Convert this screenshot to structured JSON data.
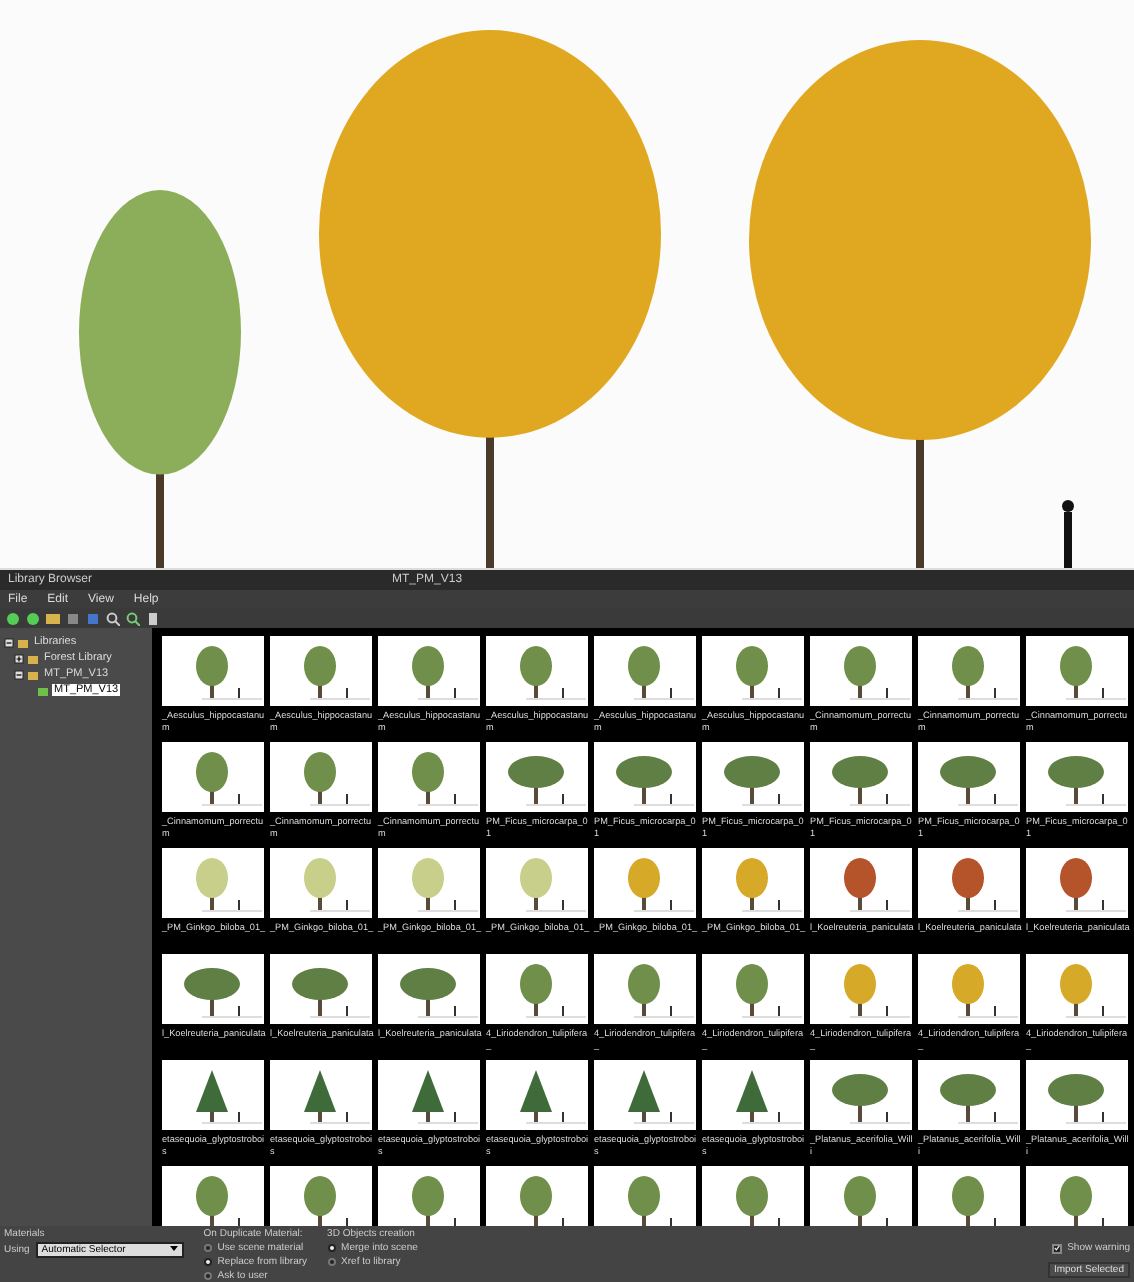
{
  "window": {
    "title": "Library Browser",
    "document": "MT_PM_V13"
  },
  "menu": [
    "File",
    "Edit",
    "View",
    "Help"
  ],
  "sidebar": {
    "items": [
      {
        "label": "Libraries",
        "expanded": true,
        "selected": false,
        "children": [
          {
            "label": "Forest Library",
            "expanded": false,
            "selected": false
          },
          {
            "label": "MT_PM_V13",
            "expanded": true,
            "selected": false,
            "children": [
              {
                "label": "MT_PM_V13",
                "selected": true
              }
            ]
          }
        ]
      }
    ]
  },
  "thumbnails": [
    {
      "label": "_Aesculus_hippocastanum",
      "kind": "green"
    },
    {
      "label": "_Aesculus_hippocastanum",
      "kind": "green"
    },
    {
      "label": "_Aesculus_hippocastanum",
      "kind": "green"
    },
    {
      "label": "_Aesculus_hippocastanum",
      "kind": "green"
    },
    {
      "label": "_Aesculus_hippocastanum",
      "kind": "green"
    },
    {
      "label": "_Aesculus_hippocastanum",
      "kind": "green"
    },
    {
      "label": "_Cinnamomum_porrectum",
      "kind": "green"
    },
    {
      "label": "_Cinnamomum_porrectum",
      "kind": "green"
    },
    {
      "label": "_Cinnamomum_porrectum",
      "kind": "green"
    },
    {
      "label": "_Cinnamomum_porrectum",
      "kind": "green"
    },
    {
      "label": "_Cinnamomum_porrectum",
      "kind": "green"
    },
    {
      "label": "_Cinnamomum_porrectum",
      "kind": "green"
    },
    {
      "label": "PM_Ficus_microcarpa_01",
      "kind": "wide"
    },
    {
      "label": "PM_Ficus_microcarpa_01",
      "kind": "wide"
    },
    {
      "label": "PM_Ficus_microcarpa_01",
      "kind": "wide"
    },
    {
      "label": "PM_Ficus_microcarpa_01",
      "kind": "wide"
    },
    {
      "label": "PM_Ficus_microcarpa_01",
      "kind": "wide"
    },
    {
      "label": "PM_Ficus_microcarpa_01",
      "kind": "wide"
    },
    {
      "label": "_PM_Ginkgo_biloba_01_",
      "kind": "pale"
    },
    {
      "label": "_PM_Ginkgo_biloba_01_",
      "kind": "pale"
    },
    {
      "label": "_PM_Ginkgo_biloba_01_",
      "kind": "pale"
    },
    {
      "label": "_PM_Ginkgo_biloba_01_",
      "kind": "pale"
    },
    {
      "label": "_PM_Ginkgo_biloba_01_",
      "kind": "yellow"
    },
    {
      "label": "_PM_Ginkgo_biloba_01_",
      "kind": "yellow"
    },
    {
      "label": "l_Koelreuteria_paniculata",
      "kind": "red"
    },
    {
      "label": "l_Koelreuteria_paniculata",
      "kind": "red"
    },
    {
      "label": "l_Koelreuteria_paniculata",
      "kind": "red"
    },
    {
      "label": "l_Koelreuteria_paniculata",
      "kind": "wide"
    },
    {
      "label": "l_Koelreuteria_paniculata",
      "kind": "wide"
    },
    {
      "label": "l_Koelreuteria_paniculata",
      "kind": "wide"
    },
    {
      "label": "4_Liriodendron_tulipifera_",
      "kind": "green"
    },
    {
      "label": "4_Liriodendron_tulipifera_",
      "kind": "green"
    },
    {
      "label": "4_Liriodendron_tulipifera_",
      "kind": "green"
    },
    {
      "label": "4_Liriodendron_tulipifera_",
      "kind": "yellow"
    },
    {
      "label": "4_Liriodendron_tulipifera_",
      "kind": "yellow"
    },
    {
      "label": "4_Liriodendron_tulipifera_",
      "kind": "yellow"
    },
    {
      "label": "etasequoia_glyptostrobois",
      "kind": "conifer"
    },
    {
      "label": "etasequoia_glyptostrobois",
      "kind": "conifer"
    },
    {
      "label": "etasequoia_glyptostrobois",
      "kind": "conifer"
    },
    {
      "label": "etasequoia_glyptostrobois",
      "kind": "conifer"
    },
    {
      "label": "etasequoia_glyptostrobois",
      "kind": "conifer"
    },
    {
      "label": "etasequoia_glyptostrobois",
      "kind": "conifer"
    },
    {
      "label": "_Platanus_acerifolia_Willi",
      "kind": "wide"
    },
    {
      "label": "_Platanus_acerifolia_Willi",
      "kind": "wide"
    },
    {
      "label": "_Platanus_acerifolia_Willi",
      "kind": "wide"
    },
    {
      "kind": "green"
    },
    {
      "kind": "green"
    },
    {
      "kind": "green"
    },
    {
      "kind": "green"
    },
    {
      "kind": "green"
    },
    {
      "kind": "green"
    },
    {
      "kind": "green"
    },
    {
      "kind": "green"
    },
    {
      "kind": "green"
    }
  ],
  "materials": {
    "title": "Materials",
    "using_label": "Using",
    "using_value": "Automatic Selector"
  },
  "duplicate": {
    "title": "On Duplicate Material:",
    "options": [
      {
        "label": "Use scene material",
        "selected": false
      },
      {
        "label": "Replace from library",
        "selected": true
      },
      {
        "label": "Ask to user",
        "selected": false
      }
    ]
  },
  "creation": {
    "title": "3D Objects creation",
    "options": [
      {
        "label": "Merge into scene",
        "selected": true
      },
      {
        "label": "Xref to library",
        "selected": false
      }
    ]
  },
  "show_warnings": {
    "label": "Show warning",
    "checked": true
  },
  "import_button": "Import Selected"
}
